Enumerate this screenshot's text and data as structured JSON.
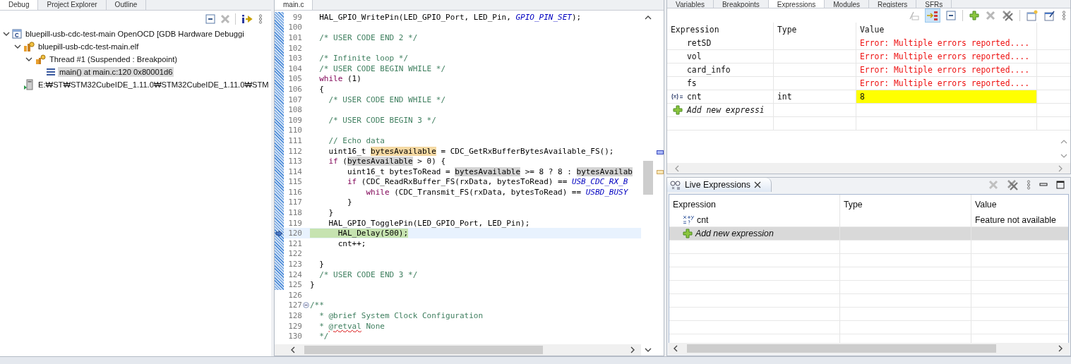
{
  "debug_view": {
    "tabs": [
      {
        "label": "Debug",
        "selected": true
      },
      {
        "label": "Project Explorer",
        "selected": false
      },
      {
        "label": "Outline",
        "selected": false
      }
    ],
    "tree": [
      {
        "label": "bluepill-usb-cdc-test-main OpenOCD [GDB Hardware Debuggi",
        "kind": "launch",
        "expanded": true,
        "selected": false,
        "children": [
          {
            "label": "bluepill-usb-cdc-test-main.elf",
            "kind": "process",
            "expanded": true,
            "selected": false,
            "children": [
              {
                "label": "Thread #1 (Suspended : Breakpoint)",
                "kind": "thread",
                "expanded": true,
                "selected": false,
                "children": [
                  {
                    "label": "main() at main.c:120 0x80001d6",
                    "kind": "frame",
                    "selected": true
                  }
                ]
              }
            ]
          },
          {
            "label": "E:₩ST₩STM32CubeIDE_1.11.0₩STM32CubeIDE_1.11.0₩STM",
            "kind": "gdb",
            "selected": false
          }
        ]
      }
    ]
  },
  "editor": {
    "tabs": [
      {
        "label": "main.c",
        "selected": true
      }
    ],
    "lines": [
      {
        "num": "99",
        "segs": [
          {
            "t": "  HAL_GPIO_WritePin(LED_GPIO_Port, LED_Pin, ",
            "kind": "plain"
          },
          {
            "t": "GPIO_PIN_SET",
            "kind": "const"
          },
          {
            "t": ");",
            "kind": "plain"
          }
        ]
      },
      {
        "num": "100"
      },
      {
        "num": "101",
        "segs": [
          {
            "t": "  /* USER CODE END 2 */",
            "kind": "comment"
          }
        ]
      },
      {
        "num": "102"
      },
      {
        "num": "103",
        "segs": [
          {
            "t": "  /* Infinite loop */",
            "kind": "comment"
          }
        ]
      },
      {
        "num": "104",
        "segs": [
          {
            "t": "  /* USER CODE BEGIN WHILE */",
            "kind": "comment"
          }
        ]
      },
      {
        "num": "105",
        "segs": [
          {
            "t": "  while",
            "kind": "keyword"
          },
          {
            "t": " (1)",
            "kind": "plain"
          }
        ]
      },
      {
        "num": "106",
        "segs": [
          {
            "t": "  {",
            "kind": "plain"
          }
        ]
      },
      {
        "num": "107",
        "segs": [
          {
            "t": "    /* USER CODE END WHILE */",
            "kind": "comment"
          }
        ]
      },
      {
        "num": "108"
      },
      {
        "num": "109",
        "segs": [
          {
            "t": "    /* USER CODE BEGIN 3 */",
            "kind": "comment"
          }
        ]
      },
      {
        "num": "110"
      },
      {
        "num": "111",
        "segs": [
          {
            "t": "    // Echo data",
            "kind": "comment"
          }
        ]
      },
      {
        "num": "112",
        "segs": [
          {
            "t": "    uint16_t ",
            "kind": "plain"
          },
          {
            "t": "bytesAvailable",
            "kind": "write"
          },
          {
            "t": " = CDC_GetRxBufferBytesAvailable_FS();",
            "kind": "plain"
          }
        ]
      },
      {
        "num": "113",
        "segs": [
          {
            "t": "    if",
            "kind": "keyword"
          },
          {
            "t": " (",
            "kind": "plain"
          },
          {
            "t": "bytesAvailable",
            "kind": "read"
          },
          {
            "t": " > 0) {",
            "kind": "plain"
          }
        ]
      },
      {
        "num": "114",
        "segs": [
          {
            "t": "        uint16_t bytesToRead = ",
            "kind": "plain"
          },
          {
            "t": "bytesAvailable",
            "kind": "read"
          },
          {
            "t": " >= 8 ? 8 : ",
            "kind": "plain"
          },
          {
            "t": "bytesAvailab",
            "kind": "read"
          }
        ]
      },
      {
        "num": "115",
        "segs": [
          {
            "t": "        if",
            "kind": "keyword"
          },
          {
            "t": " (CDC_ReadRxBuffer_FS(rxData, bytesToRead) == ",
            "kind": "plain"
          },
          {
            "t": "USB_CDC_RX_B",
            "kind": "const"
          }
        ]
      },
      {
        "num": "116",
        "segs": [
          {
            "t": "            while",
            "kind": "keyword"
          },
          {
            "t": " (CDC_Transmit_FS(rxData, bytesToRead) == ",
            "kind": "plain"
          },
          {
            "t": "USBD_BUSY",
            "kind": "const"
          }
        ]
      },
      {
        "num": "117",
        "segs": [
          {
            "t": "        }",
            "kind": "plain"
          }
        ]
      },
      {
        "num": "118",
        "segs": [
          {
            "t": "    }",
            "kind": "plain"
          }
        ]
      },
      {
        "num": "119",
        "segs": [
          {
            "t": "    HAL_GPIO_TogglePin(LED_GPIO_Port, LED_Pin);",
            "kind": "plain"
          }
        ]
      },
      {
        "num": "120",
        "current": true,
        "segs": [
          {
            "t": "      HAL_Delay(500);",
            "kind": "plain"
          }
        ]
      },
      {
        "num": "121",
        "segs": [
          {
            "t": "      cnt++;",
            "kind": "plain"
          }
        ]
      },
      {
        "num": "122"
      },
      {
        "num": "123",
        "segs": [
          {
            "t": "  }",
            "kind": "plain"
          }
        ]
      },
      {
        "num": "124",
        "segs": [
          {
            "t": "  /* USER CODE END 3 */",
            "kind": "comment"
          }
        ]
      },
      {
        "num": "125",
        "segs": [
          {
            "t": "}",
            "kind": "plain"
          }
        ]
      },
      {
        "num": "126"
      },
      {
        "num": "127",
        "fold": true,
        "segs": [
          {
            "t": "/**",
            "kind": "comment"
          }
        ]
      },
      {
        "num": "128",
        "segs": [
          {
            "t": "  * @brief System Clock Configuration",
            "kind": "comment"
          }
        ]
      },
      {
        "num": "129",
        "segs": [
          {
            "t": "  * ",
            "kind": "comment"
          },
          {
            "t": "@retval",
            "kind": "typo"
          },
          {
            "t": " None",
            "kind": "comment"
          }
        ]
      },
      {
        "num": "130",
        "segs": [
          {
            "t": "  */",
            "kind": "comment"
          }
        ]
      }
    ]
  },
  "expressions_view": {
    "tabs": [
      {
        "label": "Variables",
        "selected": false
      },
      {
        "label": "Breakpoints",
        "selected": false
      },
      {
        "label": "Expressions",
        "selected": true
      },
      {
        "label": "Modules",
        "selected": false
      },
      {
        "label": "Registers",
        "selected": false
      },
      {
        "label": "SFRs",
        "selected": false
      }
    ],
    "columns": [
      "Expression",
      "Type",
      "Value"
    ],
    "rows": [
      {
        "kind": "error",
        "expression": "retSD",
        "value": "Error: Multiple errors reported....",
        "changed": false
      },
      {
        "kind": "error",
        "expression": "vol",
        "value": "Error: Multiple errors reported....",
        "changed": false
      },
      {
        "kind": "error",
        "expression": "card_info",
        "value": "Error: Multiple errors reported....",
        "changed": false
      },
      {
        "kind": "error",
        "expression": "fs",
        "value": "Error: Multiple errors reported....",
        "changed": false
      },
      {
        "kind": "variable",
        "expression": "cnt",
        "type": "int",
        "value": "8",
        "changed": true
      },
      {
        "kind": "add",
        "expression": "Add new expressi",
        "changed": false
      }
    ]
  },
  "live_expressions": {
    "title": "Live Expressions",
    "columns": [
      "Expression",
      "Type",
      "Value"
    ],
    "rows": [
      {
        "kind": "variable",
        "expression": "cnt",
        "value": "Feature not available",
        "selected": false
      },
      {
        "kind": "add",
        "expression": "Add new expression",
        "selected": true
      }
    ]
  }
}
